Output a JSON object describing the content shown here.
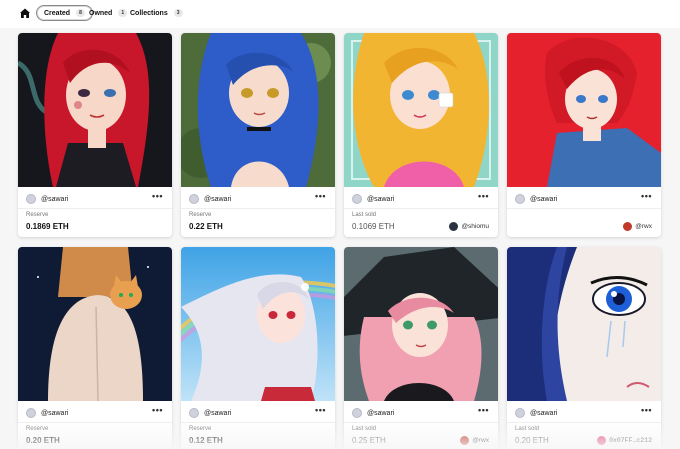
{
  "nav": {
    "home_icon": "home-icon",
    "tabs": [
      {
        "label": "Created",
        "count": "8",
        "active": true
      },
      {
        "label": "Owned",
        "count": "1",
        "active": false
      },
      {
        "label": "Collections",
        "count": "3",
        "active": false
      }
    ]
  },
  "colors": {
    "background": "#f6f6f6",
    "card": "#ffffff",
    "active_tab_border": "#8a8a8a"
  },
  "cards": [
    {
      "creator": "@sawari",
      "status": "Reserve",
      "price": "0.1869 ETH",
      "owner": "",
      "owner_avatar_color": "",
      "art": "red-haired girl with snake on black background"
    },
    {
      "creator": "@sawari",
      "status": "Reserve",
      "price": "0.22 ETH",
      "owner": "",
      "owner_avatar_color": "",
      "art": "blue-haired cat girl"
    },
    {
      "creator": "@sawari",
      "status": "Last sold",
      "price": "0.1069 ETH",
      "owner": "@shiomu",
      "owner_avatar_color": "#2a3340",
      "art": "blonde girl holding dice"
    },
    {
      "creator": "@sawari",
      "status": "",
      "price": "",
      "owner": "@rwx",
      "owner_avatar_color": "#c0392b",
      "art": "red-haired boy in denim jacket"
    },
    {
      "creator": "@sawari",
      "status": "Reserve",
      "price": "0.20 ETH",
      "owner": "",
      "owner_avatar_color": "",
      "art": "girl back view with cat on shoulder"
    },
    {
      "creator": "@sawari",
      "status": "Reserve",
      "price": "0.12 ETH",
      "owner": "",
      "owner_avatar_color": "",
      "art": "silver-haired girl with rainbow"
    },
    {
      "creator": "@sawari",
      "status": "Last sold",
      "price": "0.25 ETH",
      "owner": "@rwx",
      "owner_avatar_color": "#c0392b",
      "art": "pink-haired witch"
    },
    {
      "creator": "@sawari",
      "status": "Last sold",
      "price": "0.20 ETH",
      "owner": "0x07FF…c212",
      "owner_avatar_color": "#e84a7a",
      "art": "blue eye close-up"
    }
  ],
  "more_label": "•••"
}
